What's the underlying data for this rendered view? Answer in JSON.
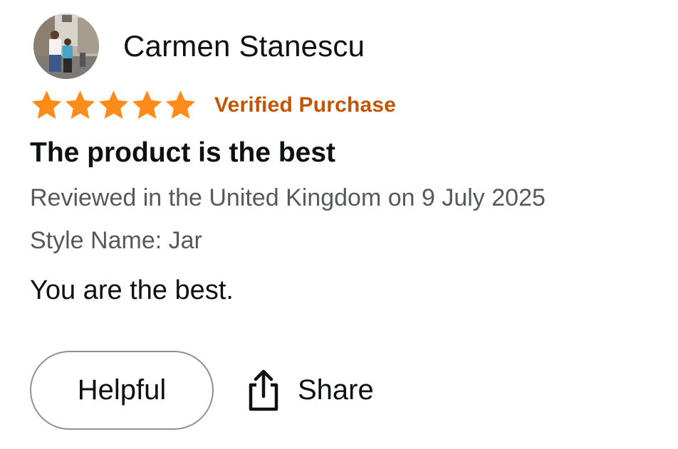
{
  "review": {
    "reviewer_name": "Carmen Stanescu",
    "avatar_icon": "user-photo-avatar",
    "rating": {
      "stars": 5,
      "max": 5,
      "color": "#ff8c1a"
    },
    "verified_label": "Verified Purchase",
    "verified_color": "#c45500",
    "title": "The product is the best",
    "date_line": "Reviewed in the United Kingdom on 9 July 2025",
    "style_line": "Style Name: Jar",
    "body": "You are the best.",
    "actions": {
      "helpful_label": "Helpful",
      "share_label": "Share",
      "share_icon": "share-icon"
    }
  }
}
